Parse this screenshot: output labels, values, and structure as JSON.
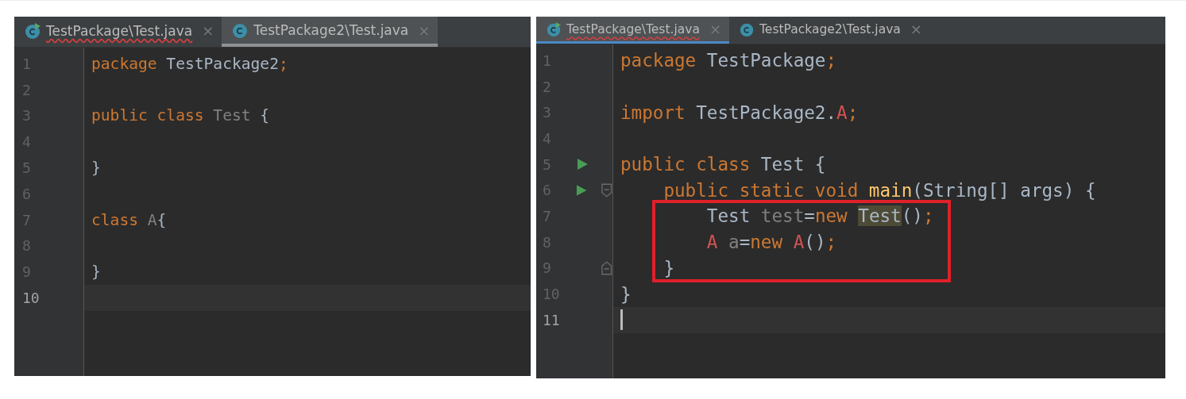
{
  "editors": [
    {
      "focused": false,
      "tabs": [
        {
          "label": "TestPackage\\Test.java",
          "selected": false,
          "error": true,
          "runnable": true,
          "close": "×"
        },
        {
          "label": "TestPackage2\\Test.java",
          "selected": true,
          "error": false,
          "runnable": false,
          "close": "×"
        }
      ],
      "lines": [
        {
          "number": "1",
          "current": false,
          "tokens": [
            {
              "text": "package",
              "kind": "keyword"
            },
            {
              "text": " TestPackage2",
              "kind": "plain"
            },
            {
              "text": ";",
              "kind": "keyword"
            }
          ]
        },
        {
          "number": "2",
          "current": false
        },
        {
          "number": "3",
          "current": false,
          "tokens": [
            {
              "text": "public class",
              "kind": "keyword"
            },
            {
              "text": " Test",
              "kind": "unused"
            },
            {
              "text": " {",
              "kind": "plain"
            }
          ]
        },
        {
          "number": "4",
          "current": false
        },
        {
          "number": "5",
          "current": false,
          "tokens": [
            {
              "text": "}",
              "kind": "plain"
            }
          ]
        },
        {
          "number": "6",
          "current": false
        },
        {
          "number": "7",
          "current": false,
          "tokens": [
            {
              "text": "class",
              "kind": "keyword"
            },
            {
              "text": " A",
              "kind": "unused"
            },
            {
              "text": "{",
              "kind": "plain"
            }
          ]
        },
        {
          "number": "8",
          "current": false
        },
        {
          "number": "9",
          "current": false,
          "tokens": [
            {
              "text": "}",
              "kind": "plain"
            }
          ]
        },
        {
          "number": "10",
          "current": true
        }
      ]
    },
    {
      "focused": true,
      "tabs": [
        {
          "label": "TestPackage\\Test.java",
          "selected": true,
          "error": true,
          "runnable": true,
          "close": "×"
        },
        {
          "label": "TestPackage2\\Test.java",
          "selected": false,
          "error": false,
          "runnable": false,
          "close": "×"
        }
      ],
      "lines": [
        {
          "number": "1",
          "current": false,
          "run": false,
          "tokens": [
            {
              "text": "package",
              "kind": "keyword"
            },
            {
              "text": " TestPackage",
              "kind": "plain"
            },
            {
              "text": ";",
              "kind": "keyword"
            }
          ]
        },
        {
          "number": "2",
          "current": false,
          "run": false
        },
        {
          "number": "3",
          "current": false,
          "run": false,
          "tokens": [
            {
              "text": "import",
              "kind": "keyword"
            },
            {
              "text": " TestPackage2.",
              "kind": "plain"
            },
            {
              "text": "A",
              "kind": "error"
            },
            {
              "text": ";",
              "kind": "keyword"
            }
          ]
        },
        {
          "number": "4",
          "current": false,
          "run": false
        },
        {
          "number": "5",
          "current": false,
          "run": true,
          "tokens": [
            {
              "text": "public class",
              "kind": "keyword"
            },
            {
              "text": " Test {",
              "kind": "plain"
            }
          ]
        },
        {
          "number": "6",
          "current": false,
          "run": true,
          "fold_open": true,
          "tokens": [
            {
              "text": "    public static void",
              "kind": "keyword"
            },
            {
              "text": " main",
              "kind": "method"
            },
            {
              "text": "(String[] args) {",
              "kind": "plain"
            }
          ]
        },
        {
          "number": "7",
          "current": false,
          "run": false,
          "boxed": true,
          "tokens": [
            {
              "text": "        Test ",
              "kind": "plain"
            },
            {
              "text": "test",
              "kind": "unused"
            },
            {
              "text": "=",
              "kind": "plain"
            },
            {
              "text": "new ",
              "kind": "keyword"
            },
            {
              "text": "Test",
              "kind": "match"
            },
            {
              "text": "()",
              "kind": "plain"
            },
            {
              "text": ";",
              "kind": "keyword"
            }
          ]
        },
        {
          "number": "8",
          "current": false,
          "run": false,
          "boxed": true,
          "tokens": [
            {
              "text": "        A",
              "kind": "error"
            },
            {
              "text": " a",
              "kind": "unused"
            },
            {
              "text": "=",
              "kind": "plain"
            },
            {
              "text": "new",
              "kind": "keyword"
            },
            {
              "text": " A",
              "kind": "error"
            },
            {
              "text": "()",
              "kind": "plain"
            },
            {
              "text": ";",
              "kind": "keyword"
            }
          ]
        },
        {
          "number": "9",
          "current": false,
          "run": false,
          "fold_close": true,
          "boxed": true,
          "tokens": [
            {
              "text": "    }",
              "kind": "plain"
            }
          ]
        },
        {
          "number": "10",
          "current": false,
          "run": false,
          "tokens": [
            {
              "text": "}",
              "kind": "plain"
            }
          ]
        },
        {
          "number": "11",
          "current": true,
          "run": false,
          "caret": true
        }
      ]
    }
  ]
}
